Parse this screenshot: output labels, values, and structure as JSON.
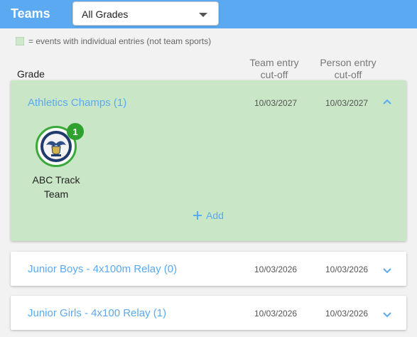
{
  "header": {
    "title": "Teams",
    "grade_select": {
      "value": "All Grades"
    }
  },
  "legend": {
    "text": "= events with individual entries (not team sports)"
  },
  "columns": {
    "grade": "Grade",
    "team_cutoff": "Team entry cut-off",
    "person_cutoff": "Person entry cut-off"
  },
  "events": [
    {
      "name": "Athletics Champs (1)",
      "team_cutoff": "10/03/2027",
      "person_cutoff": "10/03/2027",
      "expanded": true,
      "teams": [
        {
          "label": "ABC Track Team",
          "count": "1"
        }
      ],
      "add_label": "Add"
    },
    {
      "name": "Junior Boys - 4x100m Relay (0)",
      "team_cutoff": "10/03/2026",
      "person_cutoff": "10/03/2026",
      "expanded": false
    },
    {
      "name": "Junior Girls - 4x100 Relay (1)",
      "team_cutoff": "10/03/2026",
      "person_cutoff": "10/03/2026",
      "expanded": false
    }
  ],
  "colors": {
    "accent": "#5ba9f0",
    "expanded_bg": "#c9e6c7",
    "badge": "#2ea12e"
  }
}
